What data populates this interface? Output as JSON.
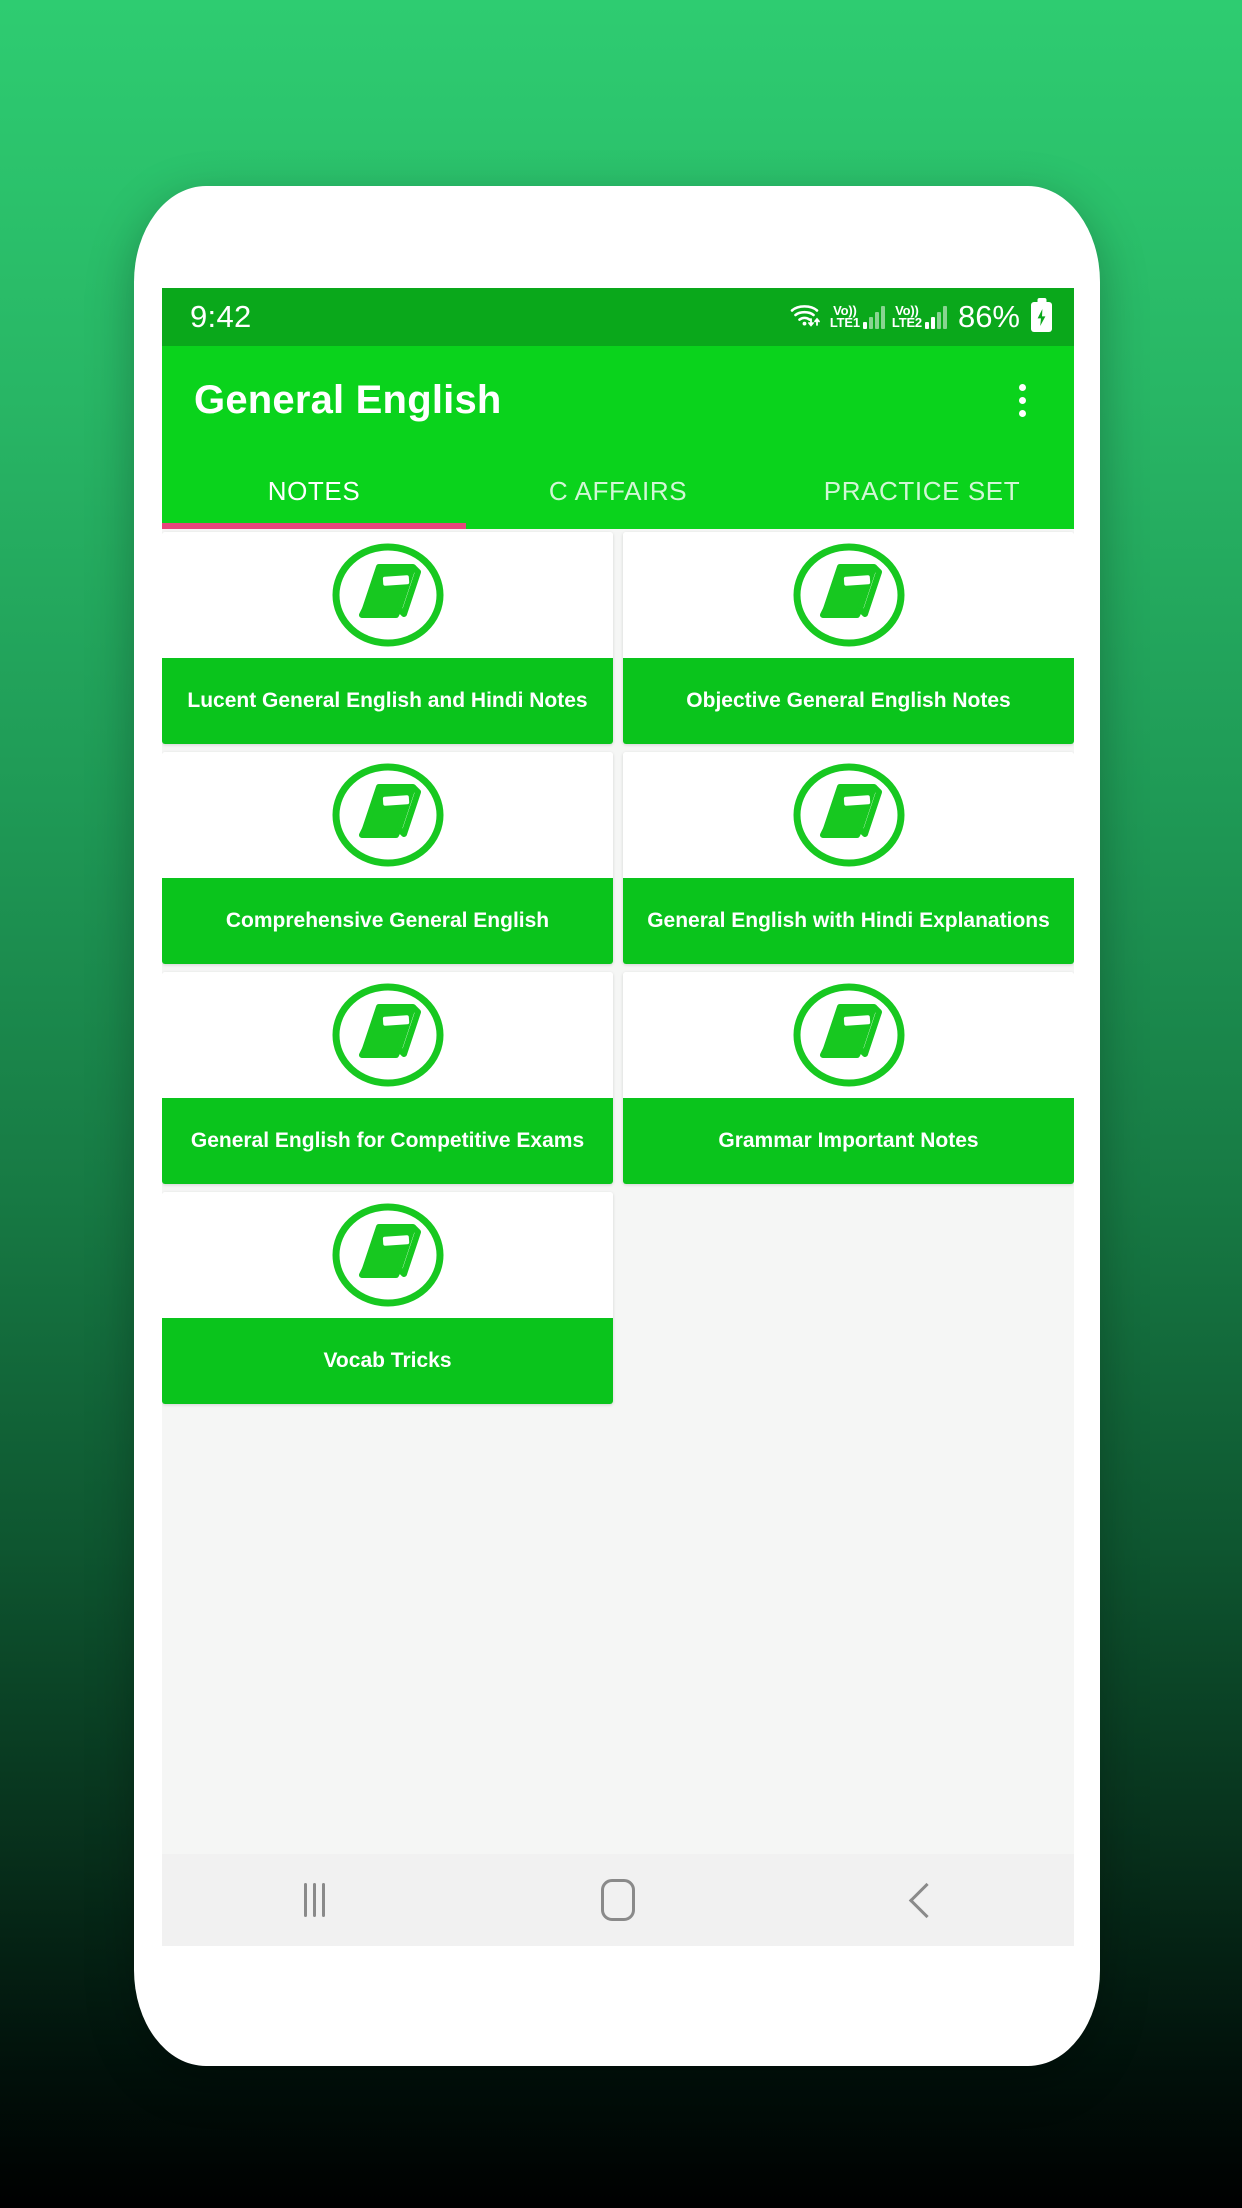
{
  "theme": {
    "backdrop_top": "#2ecc71",
    "backdrop_bottom": "#000000",
    "statusbar_green": "#0aa81b",
    "toolbar_green": "#0ad31c",
    "card_label_green": "#0ac41c",
    "tab_indicator_pink": "#e8467c",
    "screen_bg": "#f5f6f5"
  },
  "statusbar": {
    "time": "9:42",
    "wifi_icon": "wifi-icon",
    "sim1": {
      "volte_top": "Vo))",
      "volte_bottom": "LTE1",
      "signal_icon": "signal-bars-icon"
    },
    "sim2": {
      "volte_top": "Vo))",
      "volte_bottom": "LTE2",
      "signal_icon": "signal-bars-icon"
    },
    "battery_percent": "86%",
    "battery_icon": "battery-charging-icon"
  },
  "toolbar": {
    "title": "General English",
    "overflow_icon": "overflow-menu-icon"
  },
  "tabs": [
    {
      "label": "NOTES",
      "active": true
    },
    {
      "label": "C AFFAIRS",
      "active": false
    },
    {
      "label": "PRACTICE SET",
      "active": false
    }
  ],
  "grid": {
    "icon_name": "book-circle-icon",
    "items": [
      {
        "label": "Lucent General English and Hindi Notes"
      },
      {
        "label": "Objective General English Notes"
      },
      {
        "label": "Comprehensive General English"
      },
      {
        "label": "General English with Hindi Explanations"
      },
      {
        "label": "General English for Competitive Exams"
      },
      {
        "label": "Grammar Important Notes"
      },
      {
        "label": "Vocab Tricks"
      }
    ]
  },
  "navbar": {
    "recents_label": "recents-icon",
    "home_label": "home-icon",
    "back_label": "back-icon"
  }
}
